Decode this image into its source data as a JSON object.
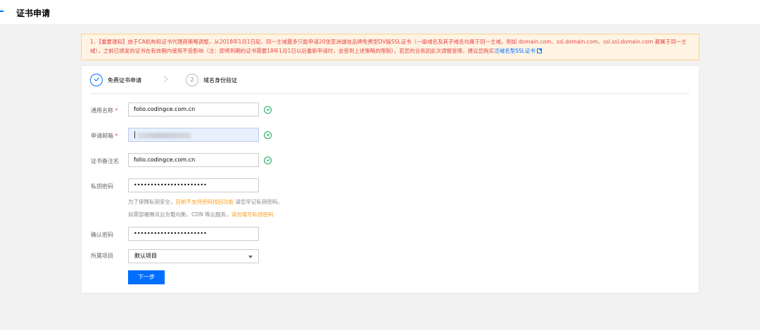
{
  "header": {
    "title": "证书申请"
  },
  "notice": {
    "text": "1、【重要通知】由于CA机构和证书代理商策略调整，从2018年1月1日起，同一主域最多只能申请20张亚洲诚信品牌免费型DV版SSL证书（一级域名及其子域名均属于同一主域，例如 domain.com、ssl.domain.com、ssl.ssl.domain.com 都属于同一主域），之前已颁发的证书在有效期内使用不受影响（注：即将到期的证书需要18年1月1日以后重新申请时，会受到上述策略的限制），若您的业务因此次调整受限，建议您购买",
    "link": "泛域名型SSL证书",
    "link_icon": "external-link-icon"
  },
  "steps": [
    {
      "index": "1",
      "label": "免费证书申请",
      "state": "active"
    },
    {
      "index": "2",
      "label": "域名身份验证",
      "state": "pending"
    }
  ],
  "form": {
    "domain_label": "通用名称",
    "domain_value": "folio.codingce.com.cn",
    "email_label": "申请邮箱",
    "remark_label": "证书备注名",
    "remark_value": "folio.codingce.com.cn",
    "key_password_label": "私钥密码",
    "key_password_value": "••••••••••••••••••••••",
    "hint1_prefix": "为了保障私钥安全，",
    "hint1_orange": "目前不支持密码找回功能",
    "hint1_suffix": "请您牢记私钥密码。",
    "hint2_prefix": "如需部署腾讯云负载均衡、CDN 等云服务，",
    "hint2_orange": "请勿填写私钥密码",
    "confirm_password_label": "确认密码",
    "confirm_password_value": "••••••••••••••••••••••",
    "project_label": "所属项目",
    "project_value": "默认项目",
    "required_mark": "*",
    "next_button": "下一步"
  },
  "colors": {
    "accent": "#006eff",
    "success": "#1aa55d",
    "warning": "#ff9c19",
    "danger": "#e54545"
  }
}
